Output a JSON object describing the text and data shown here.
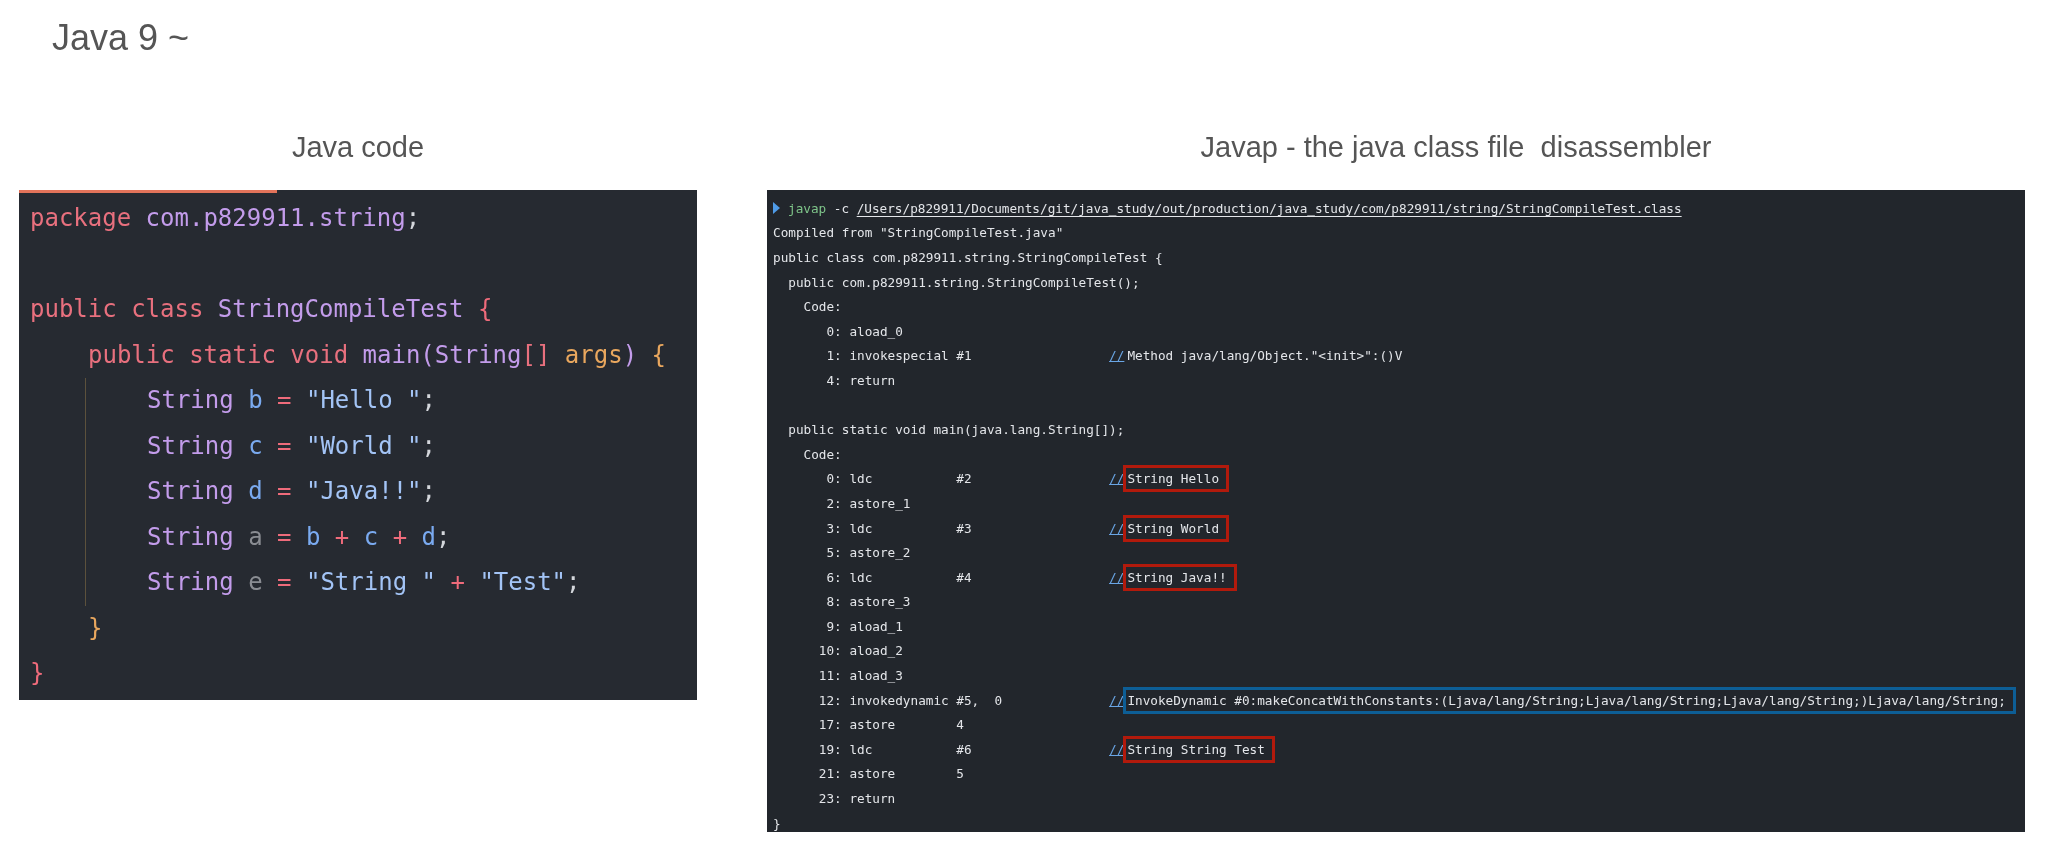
{
  "heading": "Java 9 ~",
  "java_code": {
    "caption": "Java code",
    "lines": [
      {
        "tokens": [
          {
            "kind": "keyword",
            "text": "package "
          },
          {
            "kind": "type",
            "text": "com.p829911.string"
          },
          {
            "kind": "punct",
            "text": ";"
          }
        ],
        "blank_after": true
      },
      {
        "tokens": [
          {
            "kind": "keyword",
            "text": "public class "
          },
          {
            "kind": "type",
            "text": "StringCompileTest "
          },
          {
            "kind": "brace_red",
            "text": "{"
          }
        ],
        "children": [
          {
            "tokens": [
              {
                "kind": "keyword",
                "text": "public static void "
              },
              {
                "kind": "type",
                "text": "main(String"
              },
              {
                "kind": "keyword",
                "text": "[] "
              },
              {
                "kind": "param",
                "text": "args"
              },
              {
                "kind": "type",
                "text": ") "
              },
              {
                "kind": "brace_orange",
                "text": "{"
              }
            ],
            "children": [
              {
                "tokens": [
                  {
                    "kind": "type",
                    "text": "String "
                  },
                  {
                    "kind": "variable",
                    "text": "b"
                  },
                  {
                    "kind": "operator",
                    "text": " = "
                  },
                  {
                    "kind": "string",
                    "text": "\"Hello \""
                  },
                  {
                    "kind": "punct",
                    "text": ";"
                  }
                ]
              },
              {
                "tokens": [
                  {
                    "kind": "type",
                    "text": "String "
                  },
                  {
                    "kind": "variable",
                    "text": "c"
                  },
                  {
                    "kind": "operator",
                    "text": " = "
                  },
                  {
                    "kind": "string",
                    "text": "\"World \""
                  },
                  {
                    "kind": "punct",
                    "text": ";"
                  }
                ]
              },
              {
                "tokens": [
                  {
                    "kind": "type",
                    "text": "String "
                  },
                  {
                    "kind": "variable",
                    "text": "d"
                  },
                  {
                    "kind": "operator",
                    "text": " = "
                  },
                  {
                    "kind": "string",
                    "text": "\"Java!!\""
                  },
                  {
                    "kind": "punct",
                    "text": ";"
                  }
                ]
              },
              {
                "tokens": [
                  {
                    "kind": "type",
                    "text": "String "
                  },
                  {
                    "kind": "unused",
                    "text": "a"
                  },
                  {
                    "kind": "operator",
                    "text": " = "
                  },
                  {
                    "kind": "variable",
                    "text": "b"
                  },
                  {
                    "kind": "operator",
                    "text": " + "
                  },
                  {
                    "kind": "variable",
                    "text": "c"
                  },
                  {
                    "kind": "operator",
                    "text": " + "
                  },
                  {
                    "kind": "variable",
                    "text": "d"
                  },
                  {
                    "kind": "punct",
                    "text": ";"
                  }
                ]
              },
              {
                "tokens": [
                  {
                    "kind": "type",
                    "text": "String "
                  },
                  {
                    "kind": "unused",
                    "text": "e"
                  },
                  {
                    "kind": "operator",
                    "text": " = "
                  },
                  {
                    "kind": "string",
                    "text": "\"String \""
                  },
                  {
                    "kind": "operator",
                    "text": " + "
                  },
                  {
                    "kind": "string",
                    "text": "\"Test\""
                  },
                  {
                    "kind": "punct",
                    "text": ";"
                  }
                ]
              }
            ]
          },
          {
            "tokens": [
              {
                "kind": "brace_orange",
                "text": "}"
              }
            ]
          }
        ]
      },
      {
        "tokens": [
          {
            "kind": "brace_red",
            "text": "}"
          }
        ]
      }
    ]
  },
  "javap": {
    "caption": "Javap - the java class file  disassembler",
    "command": {
      "program": "javap",
      "flag": "-c",
      "path": "/Users/p829911/Documents/git/java_study/out/production/java_study/com/p829911/string/StringCompileTest.class"
    },
    "lines": [
      {
        "text": "Compiled from \"StringCompileTest.java\""
      },
      {
        "text": "public class com.p829911.string.StringCompileTest {"
      },
      {
        "text": "  public com.p829911.string.StringCompileTest();"
      },
      {
        "text": "    Code:"
      },
      {
        "text": "       0: aload_0"
      },
      {
        "text": "       1: invokespecial #1",
        "comment": {
          "mark": "//",
          "text": "Method java/lang/Object.\"<init>\":()V"
        }
      },
      {
        "text": "       4: return",
        "blank_after": true
      },
      {
        "text": "  public static void main(java.lang.String[]);"
      },
      {
        "text": "    Code:"
      },
      {
        "text": "       0: ldc           #2",
        "comment": {
          "mark": "//",
          "text": "String Hello",
          "color": "#b21a0c"
        }
      },
      {
        "text": "       2: astore_1"
      },
      {
        "text": "       3: ldc           #3",
        "comment": {
          "mark": "//",
          "text": "String World",
          "color": "#b21a0c"
        }
      },
      {
        "text": "       5: astore_2"
      },
      {
        "text": "       6: ldc           #4",
        "comment": {
          "mark": "//",
          "text": "String Java!!",
          "color": "#b21a0c"
        }
      },
      {
        "text": "       8: astore_3"
      },
      {
        "text": "       9: aload_1"
      },
      {
        "text": "      10: aload_2"
      },
      {
        "text": "      11: aload_3"
      },
      {
        "text": "      12: invokedynamic #5,  0",
        "comment": {
          "mark": "//",
          "text": "InvokeDynamic #0:makeConcatWithConstants:(Ljava/lang/String;Ljava/lang/String;Ljava/lang/String;)Ljava/lang/String;",
          "color": "#0d5e96"
        }
      },
      {
        "text": "      17: astore        4"
      },
      {
        "text": "      19: ldc           #6",
        "comment": {
          "mark": "//",
          "text": "String String Test",
          "color": "#b21a0c"
        }
      },
      {
        "text": "      21: astore        5"
      },
      {
        "text": "      23: return"
      },
      {
        "text": "}"
      }
    ]
  }
}
